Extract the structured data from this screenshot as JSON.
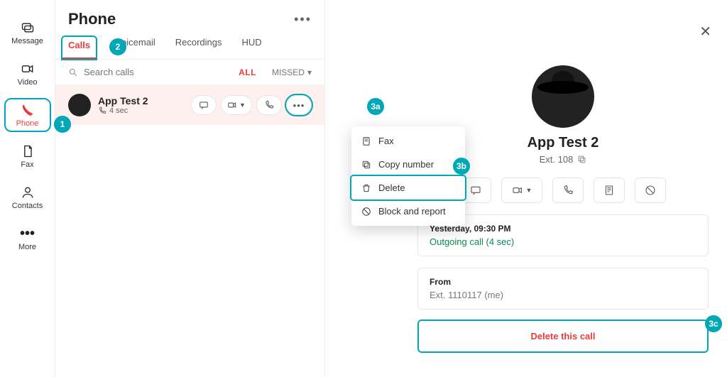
{
  "leftnav": {
    "items": [
      {
        "label": "Message"
      },
      {
        "label": "Video"
      },
      {
        "label": "Phone"
      },
      {
        "label": "Fax"
      },
      {
        "label": "Contacts"
      },
      {
        "label": "More"
      }
    ]
  },
  "header": {
    "title": "Phone"
  },
  "tabs": {
    "items": [
      {
        "label": "Calls"
      },
      {
        "label": "Voicemail"
      },
      {
        "label": "Recordings"
      },
      {
        "label": "HUD"
      }
    ]
  },
  "search": {
    "placeholder": "Search calls"
  },
  "filters": {
    "all": "ALL",
    "missed": "MISSED"
  },
  "call_list": {
    "items": [
      {
        "name": "App Test 2",
        "duration": "4 sec"
      }
    ]
  },
  "menu": {
    "items": [
      {
        "label": "Fax"
      },
      {
        "label": "Copy number"
      },
      {
        "label": "Delete"
      },
      {
        "label": "Block and report"
      }
    ]
  },
  "detail": {
    "name": "App Test 2",
    "ext": "Ext. 108",
    "time": "Yesterday, 09:30 PM",
    "status": "Outgoing call   (4 sec)",
    "from_label": "From",
    "from_value": "Ext. 1110117   (me)",
    "delete_label": "Delete this call"
  },
  "annotations": {
    "b1": "1",
    "b2": "2",
    "b3a": "3a",
    "b3b": "3b",
    "b3c": "3c"
  }
}
